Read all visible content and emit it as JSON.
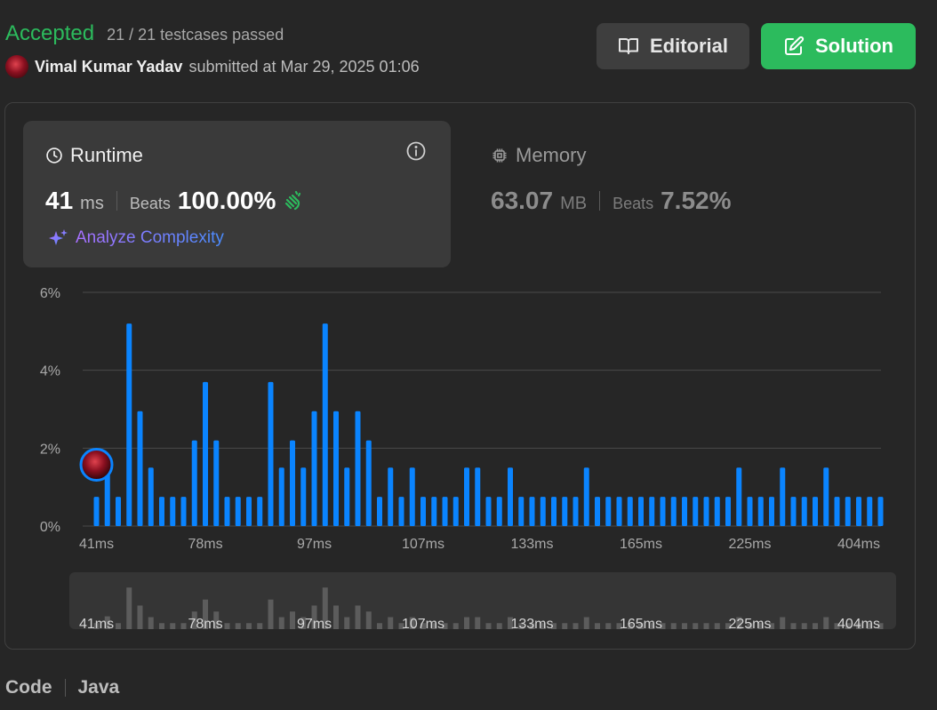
{
  "header": {
    "status": "Accepted",
    "testcases": "21 / 21 testcases passed",
    "user_name": "Vimal Kumar Yadav",
    "submitted_text": "submitted at Mar 29, 2025 01:06",
    "editorial_label": "Editorial",
    "solution_label": "Solution"
  },
  "runtime": {
    "title": "Runtime",
    "value": "41",
    "unit": "ms",
    "beats_label": "Beats",
    "beats_value": "100.00%",
    "analyze_label": "Analyze Complexity"
  },
  "memory": {
    "title": "Memory",
    "value": "63.07",
    "unit": "MB",
    "beats_label": "Beats",
    "beats_value": "7.52%"
  },
  "footer": {
    "code_label": "Code",
    "language": "Java"
  },
  "colors": {
    "accepted": "#2cbb5d",
    "bar": "#0a84ff",
    "overview_bar": "#5c5c5c"
  },
  "chart_data": {
    "type": "bar",
    "ylim": [
      0,
      6
    ],
    "ytick_labels": [
      "0%",
      "2%",
      "4%",
      "6%"
    ],
    "yticks": [
      0,
      2,
      4,
      6
    ],
    "x_labels": [
      "41ms",
      "78ms",
      "97ms",
      "107ms",
      "133ms",
      "165ms",
      "225ms",
      "404ms"
    ],
    "x_label_bar_index": [
      0,
      10,
      20,
      30,
      40,
      50,
      60,
      70
    ],
    "highlight_index": 1,
    "values": [
      0.75,
      1.6,
      0.75,
      5.2,
      2.95,
      1.5,
      0.75,
      0.75,
      0.75,
      2.2,
      3.7,
      2.2,
      0.75,
      0.75,
      0.75,
      0.75,
      3.7,
      1.5,
      2.2,
      1.5,
      2.95,
      5.2,
      2.95,
      1.5,
      2.95,
      2.2,
      0.75,
      1.5,
      0.75,
      1.5,
      0.75,
      0.75,
      0.75,
      0.75,
      1.5,
      1.5,
      0.75,
      0.75,
      1.5,
      0.75,
      0.75,
      0.75,
      0.75,
      0.75,
      0.75,
      1.5,
      0.75,
      0.75,
      0.75,
      0.75,
      0.75,
      0.75,
      0.75,
      0.75,
      0.75,
      0.75,
      0.75,
      0.75,
      0.75,
      1.5,
      0.75,
      0.75,
      0.75,
      1.5,
      0.75,
      0.75,
      0.75,
      1.5,
      0.75,
      0.75,
      0.75,
      0.75,
      0.75
    ]
  }
}
